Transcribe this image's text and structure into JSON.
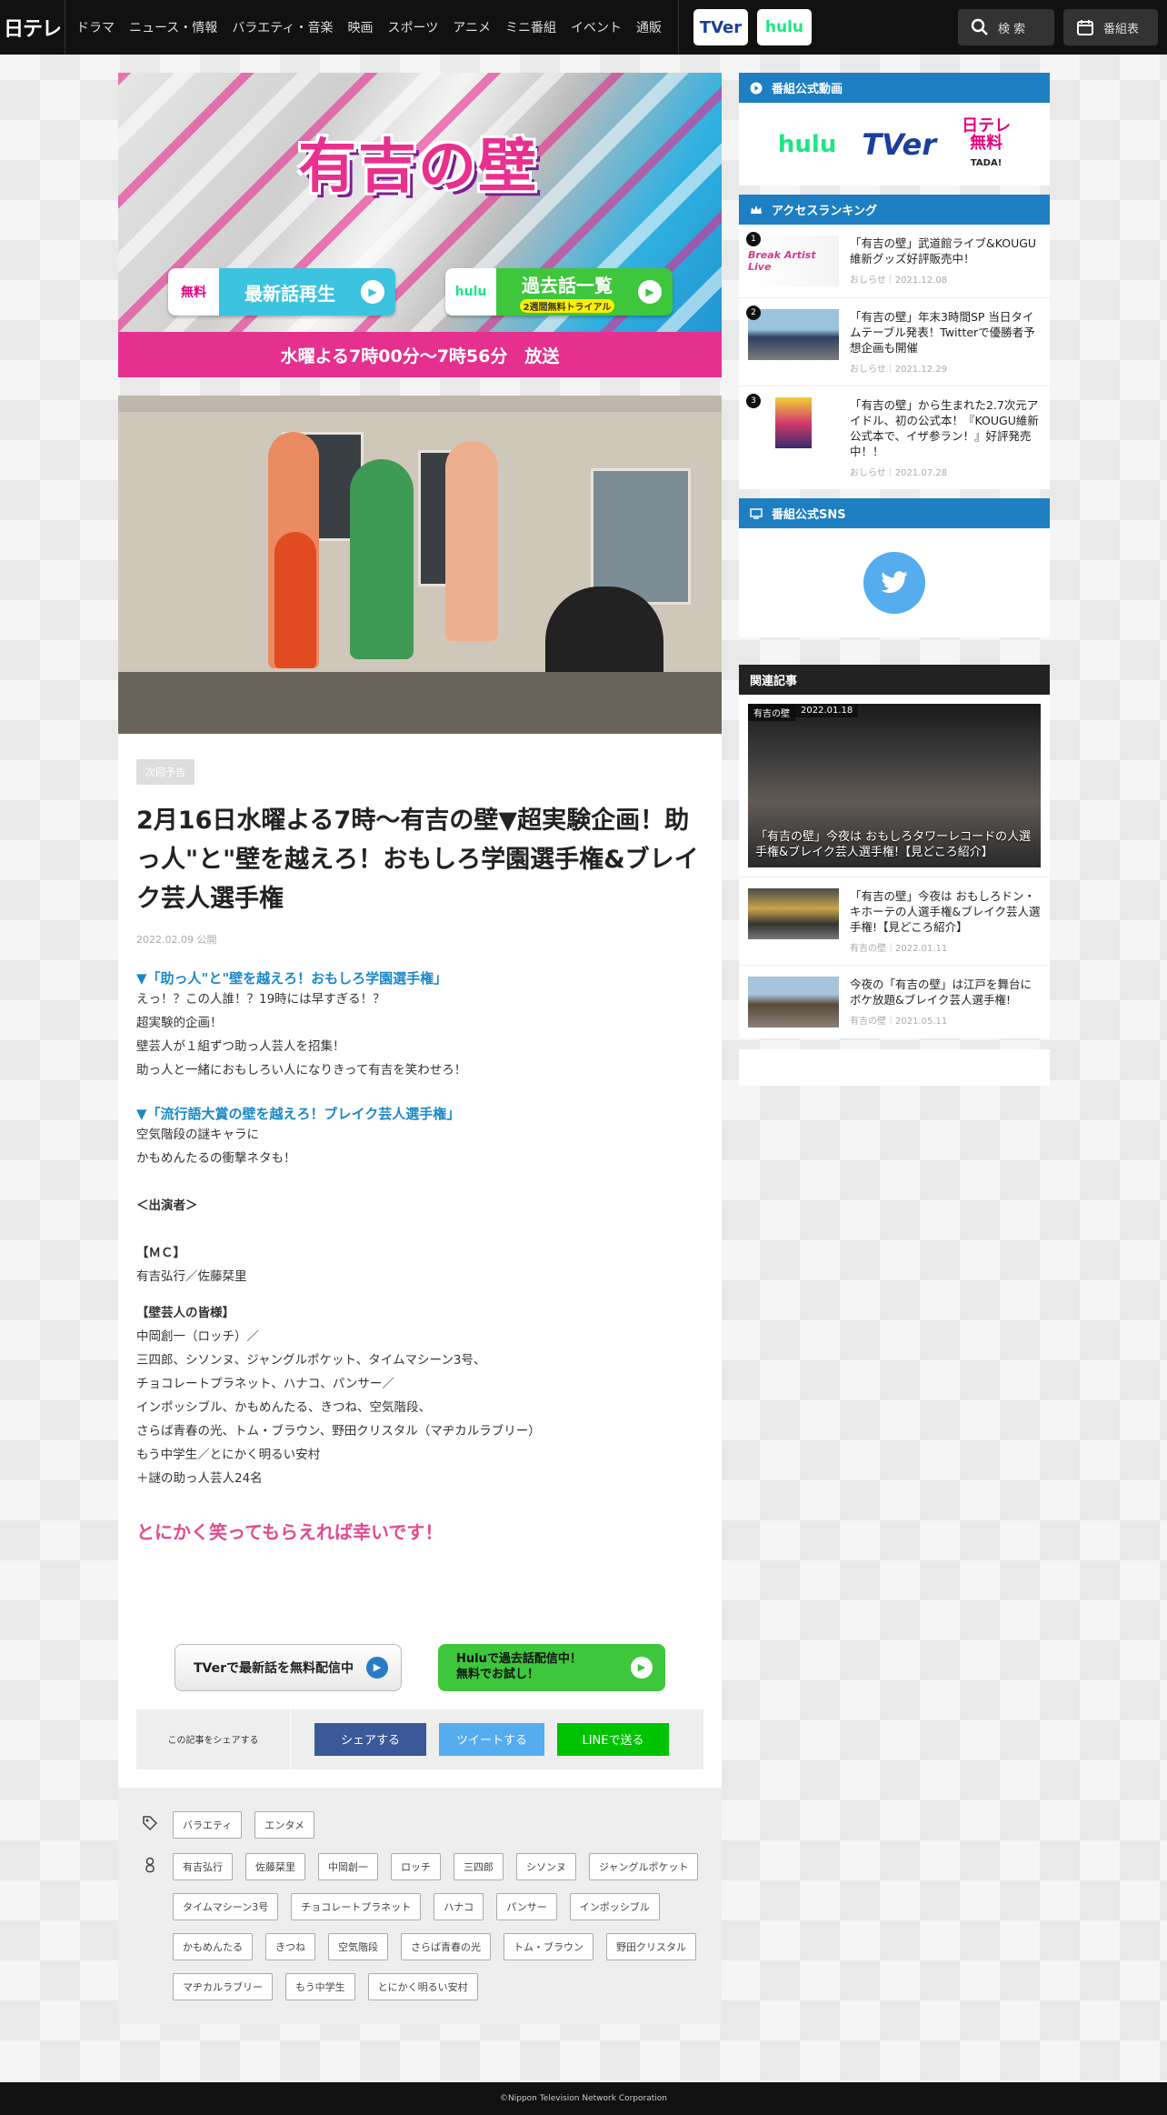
{
  "header": {
    "logo": "日テレ",
    "nav": [
      "ドラマ",
      "ニュース・情報",
      "バラエティ・音楽",
      "映画",
      "スポーツ",
      "アニメ",
      "ミニ番組",
      "イベント",
      "通販"
    ],
    "tver_label": "TVer",
    "hulu_label": "hulu",
    "search_label": "検 索",
    "tv_guide_label": "番組表"
  },
  "banner": {
    "title": "有吉の壁",
    "free_badge": "無料",
    "free_label": "最新話再生",
    "hulu_badge": "hulu",
    "past_label": "過去話一覧",
    "past_sub": "2週間無料トライアル",
    "broadcast": "水曜よる7時00分～7時56分　放送"
  },
  "article": {
    "badge": "次回予告",
    "title": "2月16日水曜よる7時～有吉の壁▼超実験企画！助っ人\"と\"壁を越えろ！おもしろ学園選手権&ブレイク芸人選手権",
    "date": "2022.02.09 公開",
    "sec1_head": "▼「助っ人\"と\"壁を越えろ！おもしろ学園選手権」",
    "sec1_lines": [
      "えっ！？この人誰！？19時には早すぎる！？",
      "超実験的企画！",
      "壁芸人が１組ずつ助っ人芸人を招集！",
      "助っ人と一緒におもしろい人になりきって有吉を笑わせろ！"
    ],
    "sec2_head": "▼「流行語大賞の壁を越えろ！ブレイク芸人選手権」",
    "sec2_lines": [
      "空気階段の謎キャラに",
      "かもめんたるの衝撃ネタも！"
    ],
    "cast_head": "＜出演者＞",
    "mc_head": "【ＭＣ】",
    "mc_line": "有吉弘行／佐藤栞里",
    "wall_head": "【壁芸人の皆様】",
    "wall_lines": [
      "中岡創一（ロッチ）／",
      "三四郎、シソンヌ、ジャングルポケット、タイムマシーン3号、",
      "チョコレートプラネット、ハナコ、パンサー／",
      "インポッシブル、かもめんたる、きつね、空気階段、",
      "さらば青春の光、トム・ブラウン、野田クリスタル（マヂカルラブリー）",
      "もう中学生／とにかく明るい安村",
      "＋謎の助っ人芸人24名"
    ],
    "closing": "とにかく笑ってもらえれば幸いです！",
    "cta_tver": "TVerで最新話を無料配信中",
    "cta_hulu_1": "Huluで過去話配信中！",
    "cta_hulu_2": "無料でお試し！",
    "share_label": "この記事をシェアする",
    "share_fb": "シェアする",
    "share_tw": "ツイートする",
    "share_line": "LINEで送る"
  },
  "tags": {
    "genre": [
      "バラエティ",
      "エンタメ"
    ],
    "people": [
      "有吉弘行",
      "佐藤栞里",
      "中岡創一",
      "ロッチ",
      "三四郎",
      "シソンヌ",
      "ジャングルポケット",
      "タイムマシーン3号",
      "チョコレートプラネット",
      "ハナコ",
      "パンサー",
      "インポッシブル",
      "かもめんたる",
      "きつね",
      "空気階段",
      "さらば青春の光",
      "トム・ブラウン",
      "野田クリスタル",
      "マヂカルラブリー",
      "もう中学生",
      "とにかく明るい安村"
    ]
  },
  "sidebar": {
    "official_video_head": "番組公式動画",
    "svc_hulu": "hulu",
    "svc_tver": "TVer",
    "svc_ntv_1": "日テレ",
    "svc_ntv_2": "無料",
    "svc_ntv_3": "TADA!",
    "ranking_head": "アクセスランキング",
    "ranking": [
      {
        "num": "1",
        "title": "「有吉の壁」武道館ライブ&KOUGU維新グッズ好評販売中！",
        "meta": "おしらせ｜2021.12.08"
      },
      {
        "num": "2",
        "title": "「有吉の壁」年末3時間SP 当日タイムテーブル発表！Twitterで優勝者予想企画も開催",
        "meta": "おしらせ｜2021.12.29"
      },
      {
        "num": "3",
        "title": "「有吉の壁」から生まれた2.7次元アイドル、初の公式本！『KOUGU維新 公式本で、イザ参ラン！』好評発売中！！",
        "meta": "おしらせ｜2021.07.28"
      }
    ],
    "sns_head": "番組公式SNS",
    "related_head": "関連記事",
    "related_big": {
      "tag": "有吉の壁",
      "date": "2022.01.18",
      "caption": "「有吉の壁」今夜は おもしろタワーレコードの人選手権&ブレイク芸人選手権!【見どころ紹介】"
    },
    "related": [
      {
        "title": "「有吉の壁」今夜は おもしろドン・キホーテの人選手権&ブレイク芸人選手権!【見どころ紹介】",
        "meta": "有吉の壁｜2022.01.11"
      },
      {
        "title": "今夜の「有吉の壁」は江戸を舞台にボケ放題&ブレイク芸人選手権!",
        "meta": "有吉の壁｜2021.05.11"
      }
    ]
  },
  "footer": {
    "copyright": "©Nippon Television Network Corporation"
  }
}
